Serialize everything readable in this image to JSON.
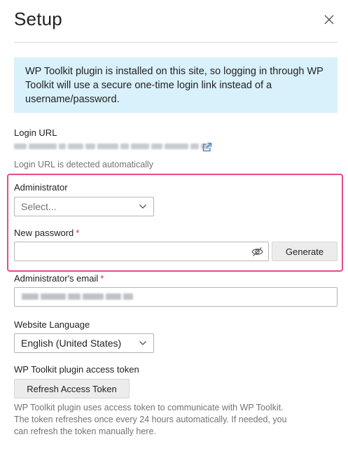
{
  "dialog": {
    "title": "Setup",
    "info_text": "WP Toolkit plugin is installed on this site, so logging in through WP Toolkit will use a secure one-time login link instead of a username/password."
  },
  "login_url": {
    "label": "Login URL",
    "hint": "Login URL is detected automatically"
  },
  "administrator": {
    "label": "Administrator",
    "selected": "Select..."
  },
  "new_password": {
    "label": "New password",
    "required_mark": "*",
    "value": "",
    "generate_label": "Generate"
  },
  "admin_email": {
    "label": "Administrator's email",
    "required_mark": "*"
  },
  "website_language": {
    "label": "Website Language",
    "selected": "English (United States)"
  },
  "access_token": {
    "label": "WP Toolkit plugin access token",
    "button_label": "Refresh Access Token",
    "hint": "WP Toolkit plugin uses access token to communicate with WP Toolkit. The token refreshes once every 24 hours automatically. If needed, you can refresh the token manually here."
  },
  "icons": [
    "close-icon",
    "external-link-icon",
    "chevron-down-icon",
    "eye-slash-icon"
  ],
  "colors": {
    "info_background": "#d9f1fa",
    "highlight_border": "#e9498a",
    "required": "#d02e3b",
    "link": "#3a7fc6"
  }
}
